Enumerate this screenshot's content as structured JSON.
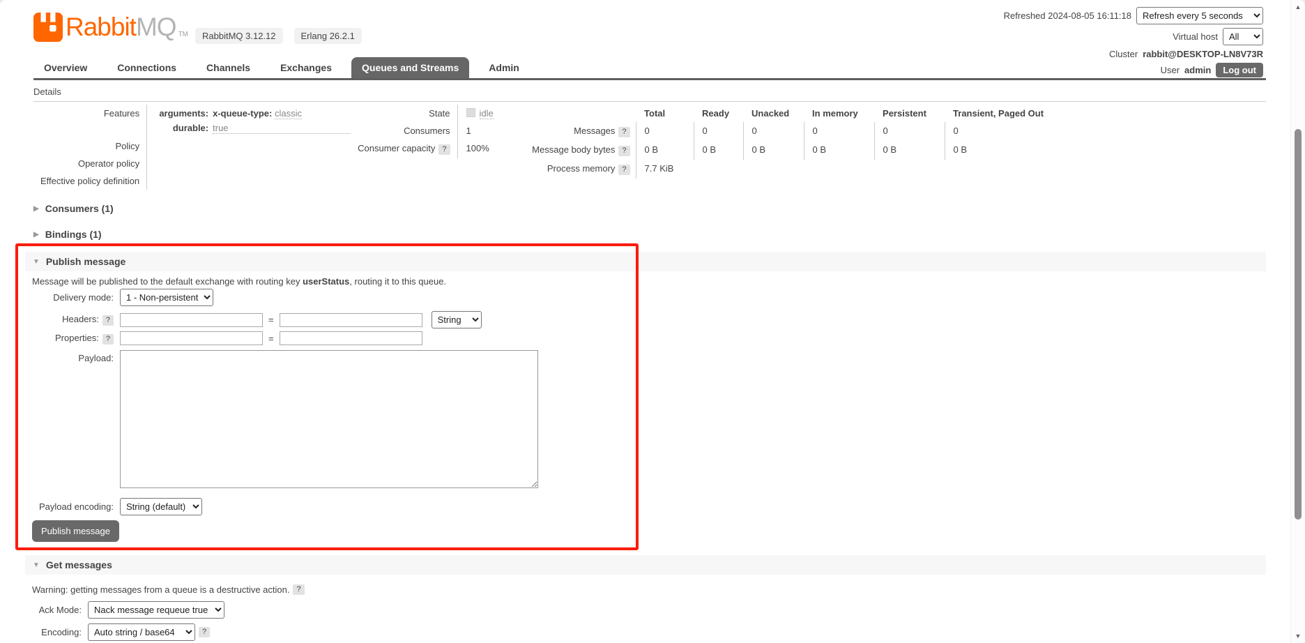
{
  "brand": {
    "rabbit": "Rabbit",
    "mq": "MQ",
    "tm": "TM",
    "version_badge": "RabbitMQ 3.12.12",
    "erlang_badge": "Erlang 26.2.1"
  },
  "topbar": {
    "refreshed": "Refreshed 2024-08-05 16:11:18",
    "refresh_interval": "Refresh every 5 seconds",
    "virtual_host_label": "Virtual host",
    "virtual_host": "All",
    "cluster_label": "Cluster",
    "cluster": "rabbit@DESKTOP-LN8V73R",
    "user_label": "User",
    "user": "admin",
    "logout": "Log out"
  },
  "tabs": {
    "overview": "Overview",
    "connections": "Connections",
    "channels": "Channels",
    "exchanges": "Exchanges",
    "queues": "Queues and Streams",
    "admin": "Admin"
  },
  "details": {
    "heading": "Details",
    "features_label": "Features",
    "arguments_key": "arguments:",
    "arguments_subkey": "x-queue-type:",
    "arguments_value": "classic",
    "durable_key": "durable:",
    "durable_value": "true",
    "policy_label": "Policy",
    "operator_policy_label": "Operator policy",
    "effective_policy_label": "Effective policy definition",
    "state_label": "State",
    "state_value": "idle",
    "consumers_label": "Consumers",
    "consumers_value": "1",
    "consumer_capacity_label": "Consumer capacity",
    "consumer_capacity_help": "?",
    "consumer_capacity_value": "100%",
    "stats": {
      "columns": [
        "Total",
        "Ready",
        "Unacked",
        "In memory",
        "Persistent",
        "Transient, Paged Out"
      ],
      "rows": [
        {
          "label": "Messages",
          "help": "?",
          "values": [
            "0",
            "0",
            "0",
            "0",
            "0",
            "0"
          ]
        },
        {
          "label": "Message body bytes",
          "help": "?",
          "values": [
            "0 B",
            "0 B",
            "0 B",
            "0 B",
            "0 B",
            "0 B"
          ]
        },
        {
          "label": "Process memory",
          "help": "?",
          "value": "7.7 KiB"
        }
      ]
    }
  },
  "sections": {
    "consumers": "Consumers (1)",
    "bindings": "Bindings (1)",
    "publish": "Publish message",
    "get": "Get messages"
  },
  "publish": {
    "intro_prefix": "Message will be published to the default exchange with routing key ",
    "routing_key": "userStatus",
    "intro_suffix": ", routing it to this queue.",
    "delivery_mode_label": "Delivery mode:",
    "delivery_mode_value": "1 - Non-persistent",
    "headers_label": "Headers:",
    "headers_help": "?",
    "equals": "=",
    "header_type_value": "String",
    "properties_label": "Properties:",
    "properties_help": "?",
    "payload_label": "Payload:",
    "payload_encoding_label": "Payload encoding:",
    "payload_encoding_value": "String (default)",
    "publish_button": "Publish message"
  },
  "get": {
    "warning": "Warning: getting messages from a queue is a destructive action.",
    "warning_help": "?",
    "ack_mode_label": "Ack Mode:",
    "ack_mode_value": "Nack message requeue true",
    "encoding_label": "Encoding:",
    "encoding_value": "Auto string / base64",
    "encoding_help": "?"
  },
  "colors": {
    "accent_orange": "#ff6600",
    "tab_active_bg": "#666666",
    "section_band_bg": "#f7f7f7",
    "annotation_red": "#fb1c0c",
    "button_bg": "#696969"
  }
}
